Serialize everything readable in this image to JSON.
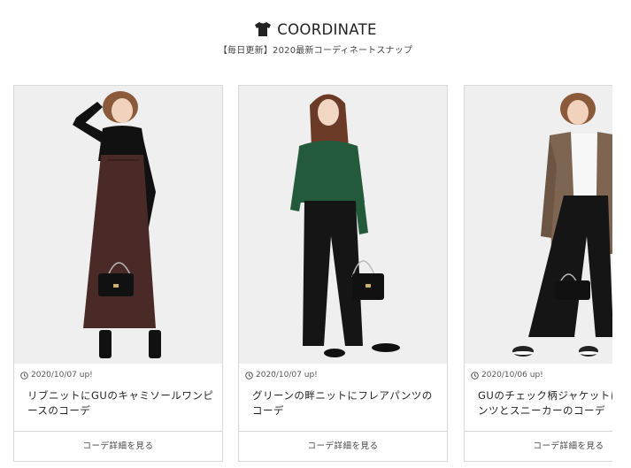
{
  "header": {
    "icon": "tshirt-icon",
    "title": "COORDINATE",
    "subtitle": "【毎日更新】2020最新コーディネートスナップ"
  },
  "cards": [
    {
      "date": "2020/10/07 up!",
      "title": "リブニットにGUのキャミソールワンピースのコーデ",
      "button": "コーデ詳細を見る",
      "image_alt": "woman in black ribbed knit with brown camisole dress and black handbag"
    },
    {
      "date": "2020/10/07 up!",
      "title": "グリーンの畔ニットにフレアパンツのコーデ",
      "button": "コーデ詳細を見る",
      "image_alt": "woman in green knit sweater with black flare pants and black handbag"
    },
    {
      "date": "2020/10/06 up!",
      "title": "GUのチェック柄ジャケットにワイドパンツとスニーカーのコーデ",
      "button": "コーデ詳細を見る",
      "image_alt": "woman in check jacket with black wide pants and sneakers"
    }
  ]
}
